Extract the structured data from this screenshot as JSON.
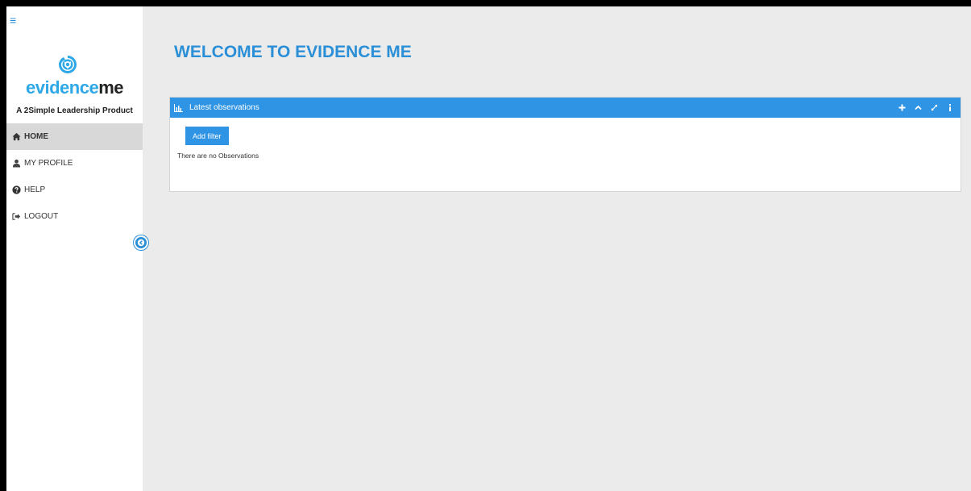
{
  "sidebar": {
    "menu_icon": "hamburger-icon",
    "logo": {
      "part1": "evidence",
      "part2": "me",
      "tagline": "A 2Simple Leadership Product",
      "icon": "evidence-me-logo-icon"
    },
    "items": [
      {
        "label": "HOME",
        "icon": "home-icon",
        "active": true
      },
      {
        "label": "MY PROFILE",
        "icon": "user-icon",
        "active": false
      },
      {
        "label": "HELP",
        "icon": "help-icon",
        "active": false
      },
      {
        "label": "LOGOUT",
        "icon": "logout-icon",
        "active": false
      }
    ],
    "collapse_icon": "arrow-left-circle-icon"
  },
  "main": {
    "title": "WELCOME TO EVIDENCE ME",
    "widget": {
      "title": "Latest observations",
      "icon": "bar-chart-icon",
      "tools": [
        "plus-icon",
        "chevron-up-icon",
        "expand-icon",
        "info-icon"
      ],
      "add_filter_label": "Add filter",
      "empty_message": "There are no Observations"
    }
  },
  "colors": {
    "accent": "#2f94e4",
    "logo_blue": "#2fa8e8",
    "background": "#ebebeb"
  }
}
